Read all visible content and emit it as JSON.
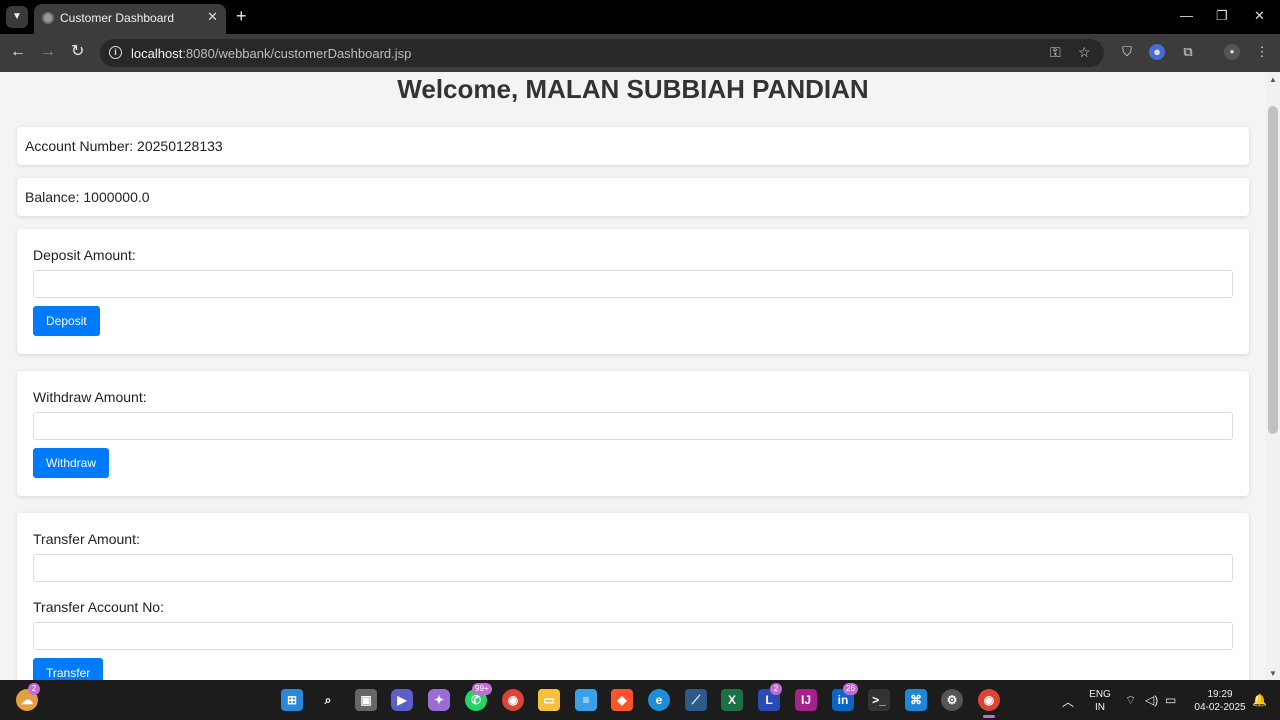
{
  "browser": {
    "tab_title": "Customer Dashboard",
    "url_host": "localhost",
    "url_path": ":8080/webbank/customerDashboard.jsp"
  },
  "page": {
    "welcome": "Welcome, MALAN SUBBIAH PANDIAN",
    "account_number": "Account Number: 20250128133",
    "balance": "Balance: 1000000.0"
  },
  "deposit": {
    "label": "Deposit Amount:",
    "value": "",
    "button": "Deposit"
  },
  "withdraw": {
    "label": "Withdraw Amount:",
    "value": "",
    "button": "Withdraw"
  },
  "transfer": {
    "amount_label": "Transfer Amount:",
    "amount_value": "",
    "account_label": "Transfer Account No:",
    "account_value": "",
    "button": "Transfer"
  },
  "taskbar": {
    "weather_badge": "2",
    "whatsapp_badge": "99+",
    "app_l_badge": "2",
    "linkedin_badge": "26",
    "language": "ENG",
    "region": "IN",
    "time": "19:29",
    "date": "04-02-2025"
  },
  "colors": {
    "primary_button": "#007bff",
    "page_background": "#f4f4f4",
    "heading_text": "#333333"
  }
}
